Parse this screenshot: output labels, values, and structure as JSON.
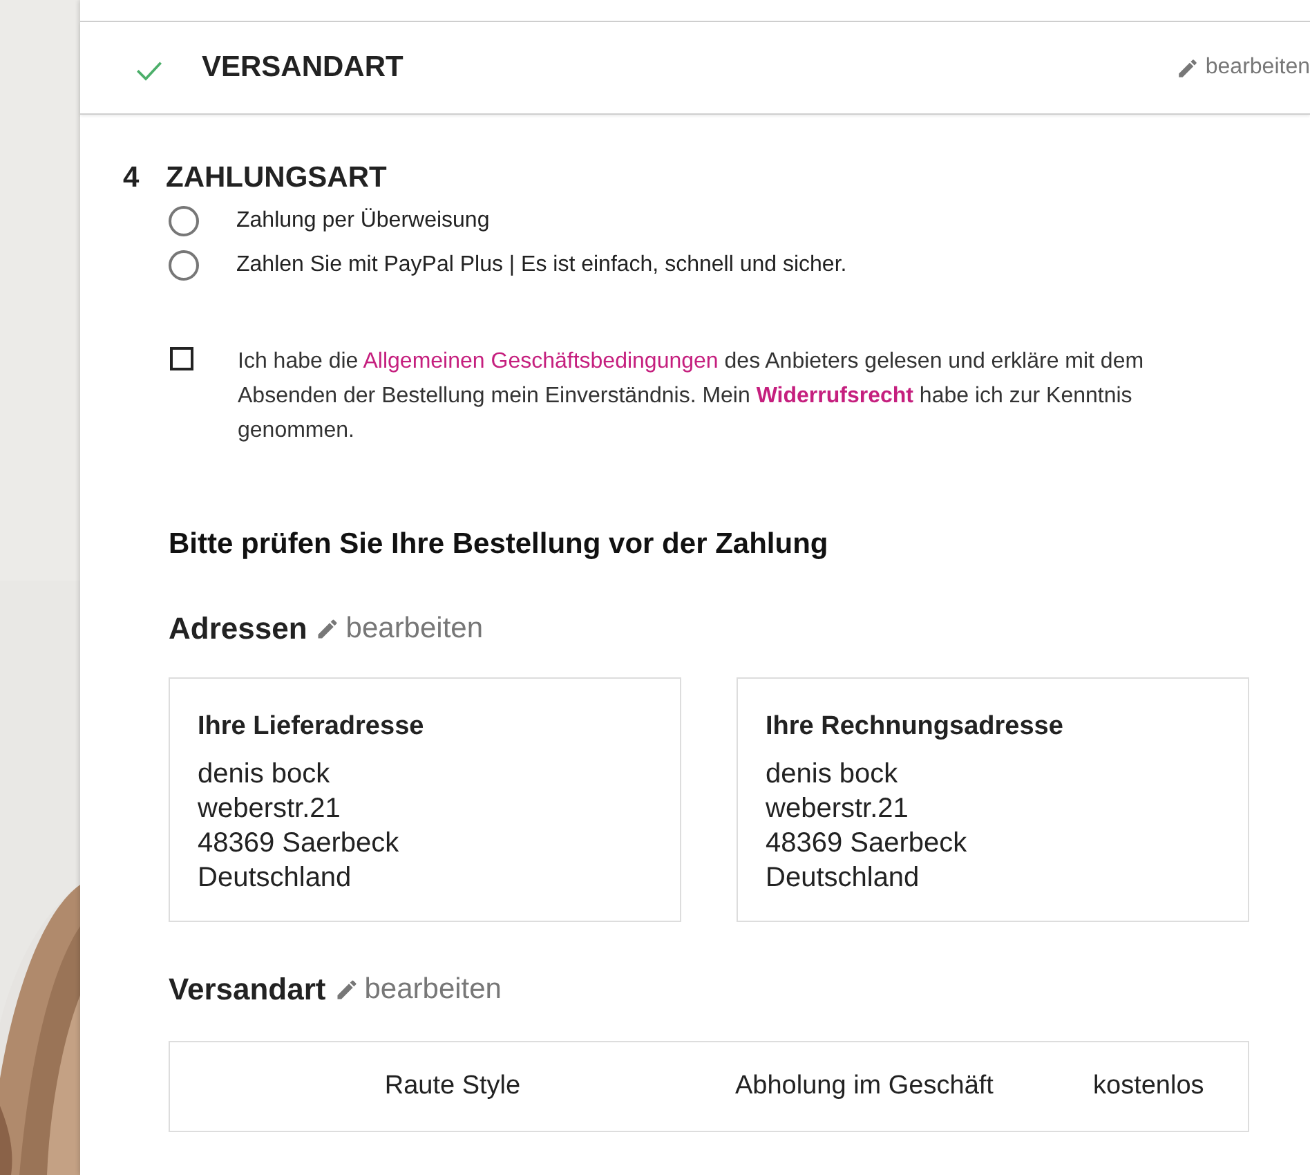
{
  "shipping_step": {
    "title": "VERSANDART",
    "completed": true,
    "edit_link": "bearbeiten"
  },
  "payment_step": {
    "number": "4",
    "title": "ZAHLUNGSART",
    "options": [
      {
        "label": "Zahlung per Überweisung",
        "selected": false
      },
      {
        "label": "Zahlen Sie mit PayPal Plus | Es ist einfach, schnell und sicher.",
        "selected": false
      }
    ],
    "terms": {
      "checked": false,
      "segments": [
        {
          "kind": "plain",
          "text": "Ich habe die "
        },
        {
          "kind": "link",
          "text": "Allgemeinen Geschäftsbedingungen"
        },
        {
          "kind": "plain",
          "text": " des Anbieters gelesen und erkläre mit dem Absenden der Bestellung mein Einverständnis. Mein "
        },
        {
          "kind": "bold-link",
          "text": "Widerrufsrecht"
        },
        {
          "kind": "plain",
          "text": " habe ich zur Kenntnis genommen."
        }
      ]
    }
  },
  "review": {
    "title": "Bitte prüfen Sie Ihre Bestellung vor der Zahlung",
    "addresses": {
      "title": "Adressen",
      "edit_link": "bearbeiten",
      "cards": [
        {
          "title": "Ihre Lieferadresse",
          "lines": [
            "denis bock",
            "weberstr.21",
            "48369 Saerbeck",
            "Deutschland"
          ]
        },
        {
          "title": "Ihre Rechnungsadresse",
          "lines": [
            "denis bock",
            "weberstr.21",
            "48369 Saerbeck",
            "Deutschland"
          ]
        }
      ]
    },
    "shipping": {
      "title": "Versandart",
      "edit_link": "bearbeiten",
      "row": [
        "Raute Style",
        "Abholung im Geschäft",
        "kostenlos"
      ]
    }
  }
}
